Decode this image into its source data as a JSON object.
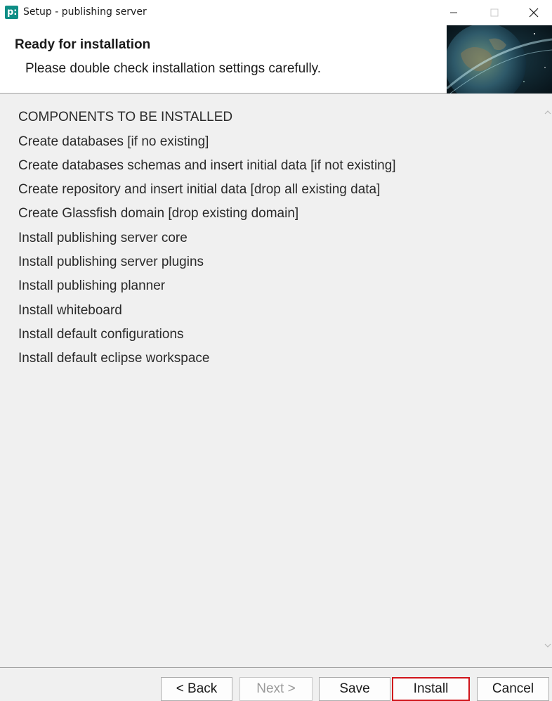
{
  "window": {
    "icon_glyph": "p:",
    "title": "Setup - publishing server"
  },
  "icons": {
    "app": "app-icon",
    "minimize": "minimize-icon",
    "maximize": "maximize-icon",
    "close": "close-icon",
    "scroll_up": "chevron-up-icon",
    "scroll_down": "chevron-down-icon"
  },
  "header": {
    "title": "Ready for installation",
    "subtitle": "Please double check installation settings carefully."
  },
  "content": {
    "lines": [
      "COMPONENTS TO BE INSTALLED",
      "Create databases [if no existing]",
      "Create databases schemas and insert initial data [if not existing]",
      "Create repository and insert initial data [drop all existing data]",
      "Create Glassfish domain [drop existing domain]",
      "Install publishing server core",
      "Install publishing server plugins",
      "Install publishing planner",
      "Install whiteboard",
      "Install default configurations",
      "Install default eclipse workspace"
    ]
  },
  "buttons": {
    "back": "< Back",
    "next": "Next >",
    "save": "Save",
    "install": "Install",
    "cancel": "Cancel"
  },
  "colors": {
    "app_icon": "#0f8e86",
    "highlight_border": "#d0151b",
    "disabled_text": "#9a9a9a"
  }
}
